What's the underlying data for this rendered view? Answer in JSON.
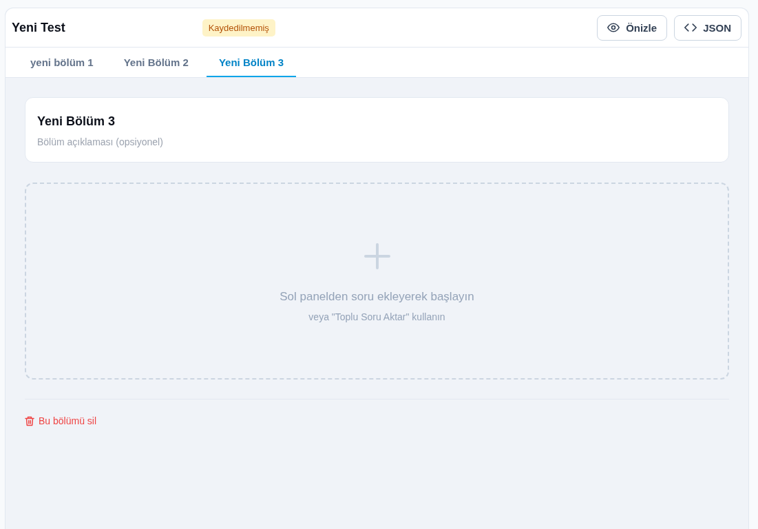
{
  "header": {
    "title": "Yeni Test",
    "status_badge": "Kaydedilmemiş",
    "buttons": [
      {
        "label": "Önizle",
        "kind": "preview"
      },
      {
        "label": "JSON",
        "kind": "code"
      }
    ]
  },
  "tabs": [
    {
      "label": "yeni bölüm 1",
      "selected": false
    },
    {
      "label": "Yeni Bölüm 2",
      "selected": false
    },
    {
      "label": "Yeni Bölüm 3",
      "selected": true
    }
  ],
  "section": {
    "title_field": {
      "value": "Yeni Bölüm 3"
    },
    "description_field": {
      "placeholder": "Bölüm açıklaması (opsiyonel)"
    }
  },
  "dropzone": {
    "message": "Sol panelden soru ekleyerek başlayın",
    "hint": "veya \"Toplu Soru Aktar\" kullanın"
  },
  "delete_link": {
    "label": "Bu bölümü sil"
  }
}
